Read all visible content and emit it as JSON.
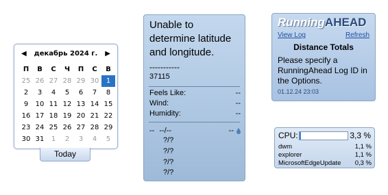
{
  "calendar": {
    "month_label": "декабрь 2024 г.",
    "weekdays": [
      "П",
      "В",
      "С",
      "Ч",
      "П",
      "С",
      "В"
    ],
    "weeks": [
      [
        "25",
        "26",
        "27",
        "28",
        "29",
        "30",
        "1"
      ],
      [
        "2",
        "3",
        "4",
        "5",
        "6",
        "7",
        "8"
      ],
      [
        "9",
        "10",
        "11",
        "12",
        "13",
        "14",
        "15"
      ],
      [
        "16",
        "17",
        "18",
        "19",
        "20",
        "21",
        "22"
      ],
      [
        "23",
        "24",
        "25",
        "26",
        "27",
        "28",
        "29"
      ],
      [
        "30",
        "31",
        "1",
        "2",
        "3",
        "4",
        "5"
      ]
    ],
    "today_button": "Today",
    "selected_color": "#2a73c4"
  },
  "weather": {
    "message": "Unable to determine latitude and longitude.",
    "dashes": "-----------",
    "zip": "37115",
    "rows": [
      {
        "label": "Feels Like:",
        "value": "--"
      },
      {
        "label": "Wind:",
        "value": "--"
      },
      {
        "label": "Humidity:",
        "value": "--"
      }
    ],
    "forecast_left": "--",
    "forecast_mid": "--/--",
    "forecast_right": "--",
    "forecast_items": [
      "?/?",
      "?/?",
      "?/?",
      "?/?"
    ]
  },
  "runningahead": {
    "title_running": "Running",
    "title_ahead": "AHEAD",
    "view_log": "View Log",
    "refresh": "Refresh",
    "heading": "Distance Totals",
    "message": "Please specify a RunningAhead Log ID in the Options.",
    "date": "01.12.24 23:03"
  },
  "cpu": {
    "label": "CPU:",
    "total": "3,3 %",
    "usage_fraction": 0.033,
    "processes": [
      {
        "name": "dwm",
        "value": "1,1 %"
      },
      {
        "name": "explorer",
        "value": "1,1 %"
      },
      {
        "name": "MicrosoftEdgeUpdate",
        "value": "0,3 %"
      }
    ]
  }
}
